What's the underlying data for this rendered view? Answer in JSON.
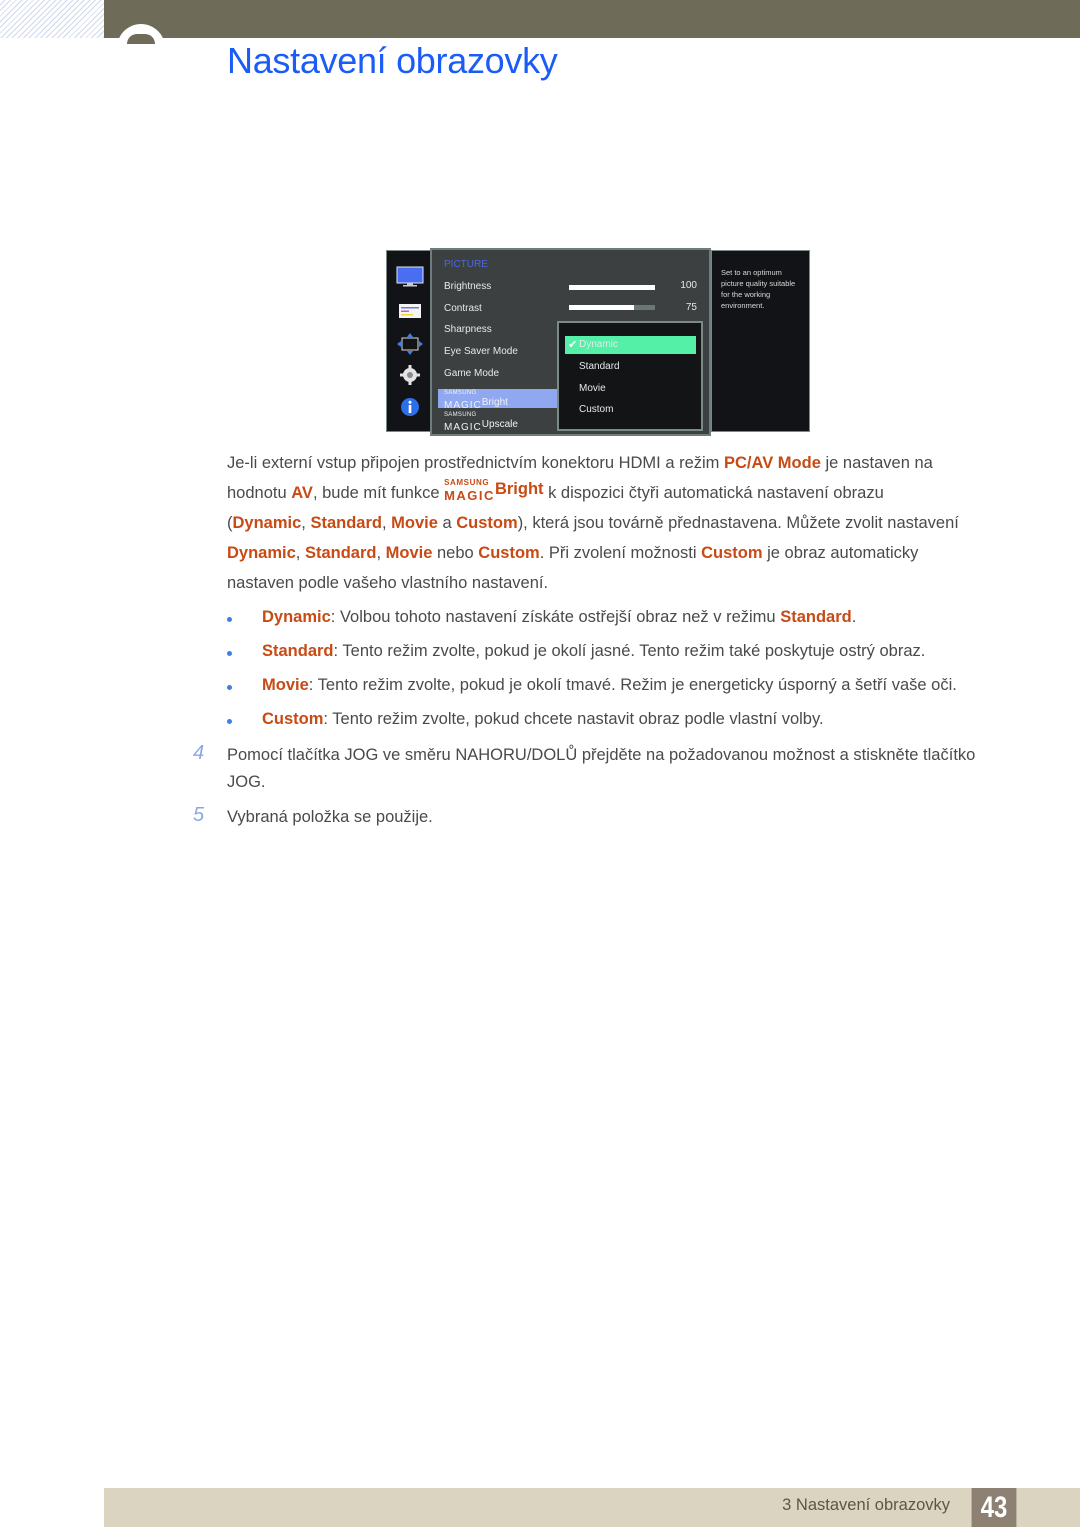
{
  "header": {
    "title": "Nastavení obrazovky"
  },
  "osd": {
    "menu_header": "PICTURE",
    "items": [
      "Brightness",
      "Contrast",
      "Sharpness",
      "Eye Saver Mode",
      "Game Mode"
    ],
    "magic_items": [
      {
        "brand_top": "SAMSUNG",
        "brand_bottom": "MAGIC",
        "word": "Bright",
        "selected": true
      },
      {
        "brand_top": "SAMSUNG",
        "brand_bottom": "MAGIC",
        "word": "Upscale",
        "selected": false
      }
    ],
    "sliders": [
      {
        "name": "Brightness",
        "value": 100,
        "value_label": "100",
        "fraction": 1.0
      },
      {
        "name": "Contrast",
        "value": 75,
        "value_label": "75",
        "fraction": 0.75
      }
    ],
    "submenu": {
      "options": [
        "Dynamic",
        "Standard",
        "Movie",
        "Custom"
      ],
      "selected": "Dynamic",
      "check_glyph": "✔"
    },
    "description": "Set to an optimum picture quality suitable for the working environment.",
    "side_icons": [
      "monitor-icon",
      "menu-list-icon",
      "resize-arrows-icon",
      "gear-icon",
      "info-icon"
    ],
    "colors": {
      "header": "#4a67e6",
      "selected_item": "#8fa8f0",
      "selected_option": "#55f0a8"
    }
  },
  "intro": {
    "line1_a": "Je-li externí vstup připojen prostřednictvím konektoru HDMI a režim ",
    "line1_hl": "PC/AV Mode",
    "line1_b": " je nastaven na",
    "line2_a": "hodnotu ",
    "line2_hl": "AV",
    "line2_b": ", bude mít funkce ",
    "magic_top": "SAMSUNG",
    "magic_bottom": "MAGIC",
    "magic_word": "Bright",
    "line2_c": " k dispozici čtyři automatická nastavení obrazu",
    "line3_open": "(",
    "line3_d": "Dynamic",
    "line3_s": "Standard",
    "line3_m": "Movie",
    "line3_and": " a ",
    "line3_c": "Custom",
    "line3_rest": "), která jsou továrně přednastavena. Můžete zvolit nastavení",
    "line4_d": "Dynamic",
    "line4_s": "Standard",
    "line4_m": "Movie",
    "line4_or": " nebo ",
    "line4_c": "Custom",
    "line4_rest_a": ". Při zvolení možnosti ",
    "line4_c2": "Custom",
    "line4_rest_b": " je obraz automaticky",
    "line5": "nastaven podle vašeho vlastního nastavení.",
    "comma": ", "
  },
  "bullets": [
    {
      "term": "Dynamic",
      "text": ": Volbou tohoto nastavení získáte ostřejší obraz než v režimu ",
      "term2": "Standard",
      "tail": "."
    },
    {
      "term": "Standard",
      "text": ": Tento režim zvolte, pokud je okolí jasné. Tento režim také poskytuje ostrý obraz."
    },
    {
      "term": "Movie",
      "text": ": Tento režim zvolte, pokud je okolí tmavé. Režim je energeticky úsporný a šetří vaše oči."
    },
    {
      "term": "Custom",
      "text": ": Tento režim zvolte, pokud chcete nastavit obraz podle vlastní volby."
    }
  ],
  "steps": [
    {
      "number": "4",
      "text": "Pomocí tlačítka JOG ve směru NAHORU/DOLŮ přejděte na požadovanou možnost a stiskněte tlačítko JOG."
    },
    {
      "number": "5",
      "text": "Vybraná položka se použije."
    }
  ],
  "footer": {
    "chapter_label": "3 Nastavení obrazovky",
    "page_number": "43"
  },
  "colors": {
    "title_blue": "#1a5cf5",
    "highlight_orange": "#c84a14",
    "topbar": "#6e6b59",
    "footer_bar": "#dbd4c1",
    "page_box": "#8c8173"
  }
}
